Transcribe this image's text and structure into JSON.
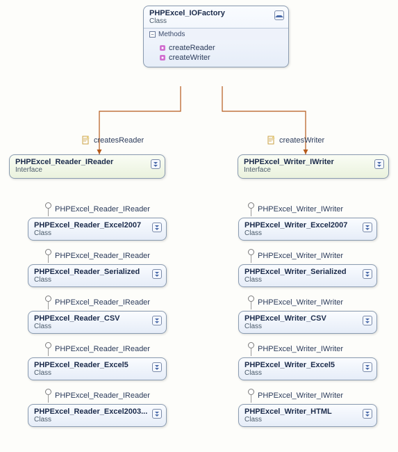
{
  "factory": {
    "title": "PHPExcel_IOFactory",
    "type": "Class",
    "methods_section": "Methods",
    "methods": [
      "createReader",
      "createWriter"
    ]
  },
  "edges": {
    "creates_reader": "createsReader",
    "creates_writer": "createsWriter"
  },
  "reader_interface": {
    "title": "PHPExcel_Reader_IReader",
    "type": "Interface",
    "label": "PHPExcel_Reader_IReader"
  },
  "writer_interface": {
    "title": "PHPExcel_Writer_IWriter",
    "type": "Interface",
    "label": "PHPExcel_Writer_IWriter"
  },
  "reader_classes": [
    {
      "title": "PHPExcel_Reader_Excel2007",
      "type": "Class"
    },
    {
      "title": "PHPExcel_Reader_Serialized",
      "type": "Class"
    },
    {
      "title": "PHPExcel_Reader_CSV",
      "type": "Class"
    },
    {
      "title": "PHPExcel_Reader_Excel5",
      "type": "Class"
    },
    {
      "title": "PHPExcel_Reader_Excel2003...",
      "type": "Class"
    }
  ],
  "writer_classes": [
    {
      "title": "PHPExcel_Writer_Excel2007",
      "type": "Class"
    },
    {
      "title": "PHPExcel_Writer_Serialized",
      "type": "Class"
    },
    {
      "title": "PHPExcel_Writer_CSV",
      "type": "Class"
    },
    {
      "title": "PHPExcel_Writer_Excel5",
      "type": "Class"
    },
    {
      "title": "PHPExcel_Writer_HTML",
      "type": "Class"
    }
  ]
}
